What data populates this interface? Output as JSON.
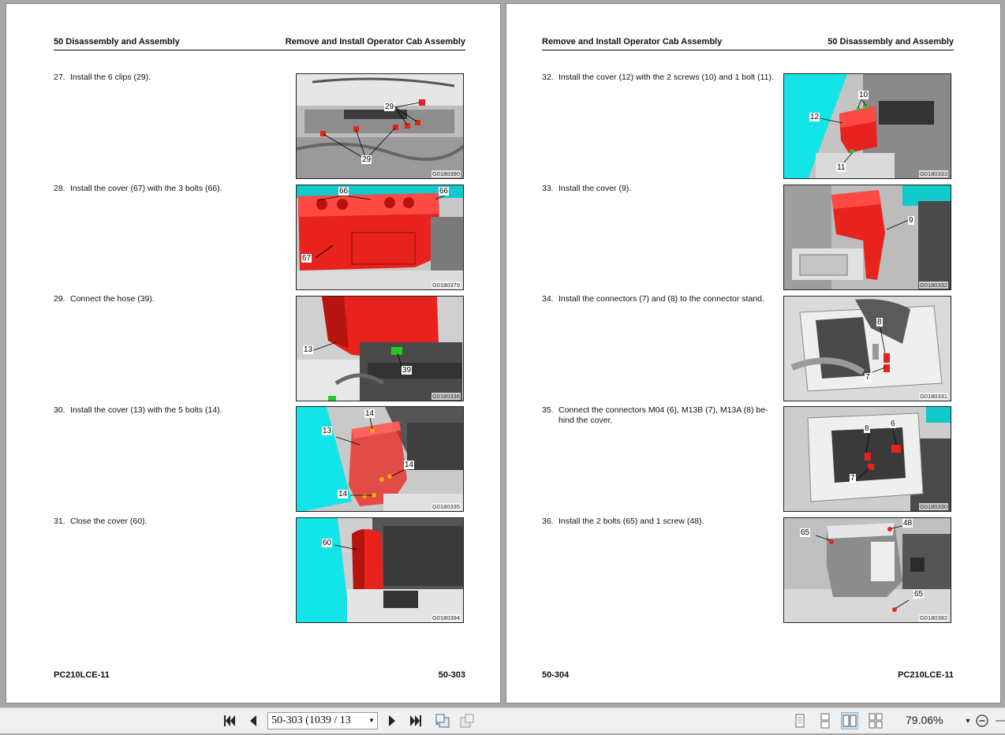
{
  "left_page": {
    "header_left": "50 Disassembly and Assembly",
    "header_right": "Remove and Install Operator Cab Assembly",
    "footer_left": "PC210LCE-11",
    "footer_right": "50-303",
    "steps": [
      {
        "num": "27.",
        "text": "Install the 6 clips (29).",
        "figure": "G0180390",
        "callouts": [
          "29",
          "29"
        ]
      },
      {
        "num": "28.",
        "text": "Install the cover (67) with the 3 bolts (66).",
        "figure": "G0180379",
        "callouts": [
          "66",
          "66",
          "67"
        ]
      },
      {
        "num": "29.",
        "text": "Connect the hose (39).",
        "figure": "G0180336",
        "callouts": [
          "13",
          "39"
        ]
      },
      {
        "num": "30.",
        "text": "Install the cover (13) with the 5 bolts (14).",
        "figure": "G0180335",
        "callouts": [
          "14",
          "13",
          "14",
          "14"
        ]
      },
      {
        "num": "31.",
        "text": "Close the cover (60).",
        "figure": "G0180394",
        "callouts": [
          "60"
        ]
      }
    ]
  },
  "right_page": {
    "header_left": "Remove and Install Operator Cab Assembly",
    "header_right": "50 Disassembly and Assembly",
    "footer_left": "50-304",
    "footer_right": "PC210LCE-11",
    "steps": [
      {
        "num": "32.",
        "text": "Install the cover (12) with the 2 screws (10) and 1 bolt (11).",
        "figure": "G0180333",
        "callouts": [
          "10",
          "12",
          "11"
        ]
      },
      {
        "num": "33.",
        "text": "Install the cover (9).",
        "figure": "G0180332",
        "callouts": [
          "9"
        ]
      },
      {
        "num": "34.",
        "text": "Install the connectors (7) and (8) to the connector stand.",
        "figure": "G0180331",
        "callouts": [
          "8",
          "7"
        ]
      },
      {
        "num": "35.",
        "text_line1": "Connect the connectors M04 (6), M13B (7), M13A (8) be-",
        "text_line2": "hind the cover.",
        "figure": "G0180330",
        "callouts": [
          "8",
          "6",
          "7"
        ]
      },
      {
        "num": "36.",
        "text": "Install the 2 bolts (65) and 1 screw (48).",
        "figure": "G0180392",
        "callouts": [
          "48",
          "65",
          "65"
        ]
      }
    ]
  },
  "toolbar": {
    "page_field_value": "50-303 (1039 / 13",
    "zoom_value": "79.06%",
    "icons": [
      "first-page-icon",
      "prev-page-icon",
      "next-page-icon",
      "last-page-icon",
      "previous-view-icon",
      "next-view-icon",
      "single-page-icon",
      "continuous-icon",
      "facing-pages-icon",
      "continuous-facing-icon",
      "zoom-dropdown-icon",
      "zoom-out-icon"
    ]
  },
  "colors": {
    "highlight_red": "#e8221c",
    "cyan": "#12e4e8",
    "green": "#22cc22",
    "viewer_bg": "#a7a7a7"
  }
}
